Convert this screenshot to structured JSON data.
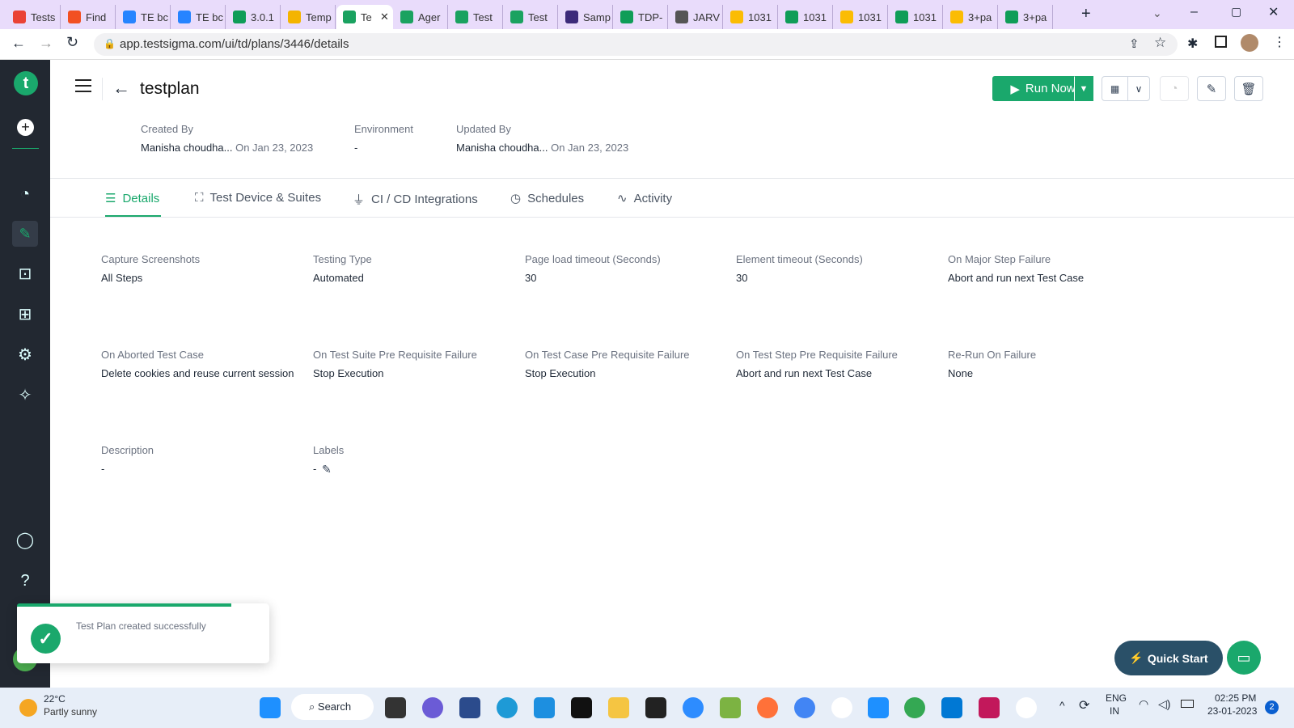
{
  "browser": {
    "tabs": [
      {
        "label": "Tests",
        "color": "#ea4335"
      },
      {
        "label": "Find",
        "color": "#f25022"
      },
      {
        "label": "TE bc",
        "color": "#2684ff"
      },
      {
        "label": "TE bc",
        "color": "#2684ff"
      },
      {
        "label": "3.0.1",
        "color": "#0f9d58"
      },
      {
        "label": "Temp",
        "color": "#f4b400"
      },
      {
        "label": "Te",
        "color": "#1aa260",
        "active": true
      },
      {
        "label": "Ager",
        "color": "#1aa260"
      },
      {
        "label": "Test",
        "color": "#1aa260"
      },
      {
        "label": "Test",
        "color": "#1aa260"
      },
      {
        "label": "Samp",
        "color": "#3c2a7a"
      },
      {
        "label": "TDP-",
        "color": "#0f9d58"
      },
      {
        "label": "JARV",
        "color": "#555"
      },
      {
        "label": "1031",
        "color": "#fbbc04"
      },
      {
        "label": "1031",
        "color": "#0f9d58"
      },
      {
        "label": "1031",
        "color": "#fbbc04"
      },
      {
        "label": "1031",
        "color": "#0f9d58"
      },
      {
        "label": "3+pa",
        "color": "#fbbc04"
      },
      {
        "label": "3+pa",
        "color": "#0f9d58"
      }
    ],
    "url": "app.testsigma.com/ui/td/plans/3446/details"
  },
  "header": {
    "title": "testplan",
    "run_now": "Run Now"
  },
  "meta": [
    {
      "label": "Created By",
      "name": "Manisha choudha...",
      "date": "On Jan 23, 2023"
    },
    {
      "label": "Environment",
      "name": "-",
      "date": ""
    },
    {
      "label": "Updated By",
      "name": "Manisha choudha...",
      "date": "On Jan 23, 2023"
    }
  ],
  "tabs": [
    "Details",
    "Test Device & Suites",
    "CI / CD Integrations",
    "Schedules",
    "Activity"
  ],
  "fields": [
    {
      "label": "Capture Screenshots",
      "value": "All Steps"
    },
    {
      "label": "Testing Type",
      "value": "Automated"
    },
    {
      "label": "Page load timeout (Seconds)",
      "value": "30"
    },
    {
      "label": "Element timeout (Seconds)",
      "value": "30"
    },
    {
      "label": "On Major Step Failure",
      "value": "Abort and run next Test Case"
    },
    {
      "label": "On Aborted Test Case",
      "value": "Delete cookies and reuse current session"
    },
    {
      "label": "On Test Suite Pre Requisite Failure",
      "value": "Stop Execution"
    },
    {
      "label": "On Test Case Pre Requisite Failure",
      "value": "Stop Execution"
    },
    {
      "label": "On Test Step Pre Requisite Failure",
      "value": "Abort and run next Test Case"
    },
    {
      "label": "Re-Run On Failure",
      "value": "None"
    },
    {
      "label": "Description",
      "value": "-"
    },
    {
      "label": "Labels",
      "value": "-"
    }
  ],
  "toast": {
    "message": "Test Plan created successfully",
    "progress": 0.85
  },
  "quick_start": "Quick Start",
  "taskbar": {
    "temp": "22°C",
    "weather": "Partly sunny",
    "search": "Search",
    "lang1": "ENG",
    "lang2": "IN",
    "time": "02:25 PM",
    "date": "23-01-2023",
    "badge": "2"
  },
  "colors": {
    "accent": "#1aa86c",
    "sidebar": "#222831",
    "quick_start": "#2a5068"
  }
}
